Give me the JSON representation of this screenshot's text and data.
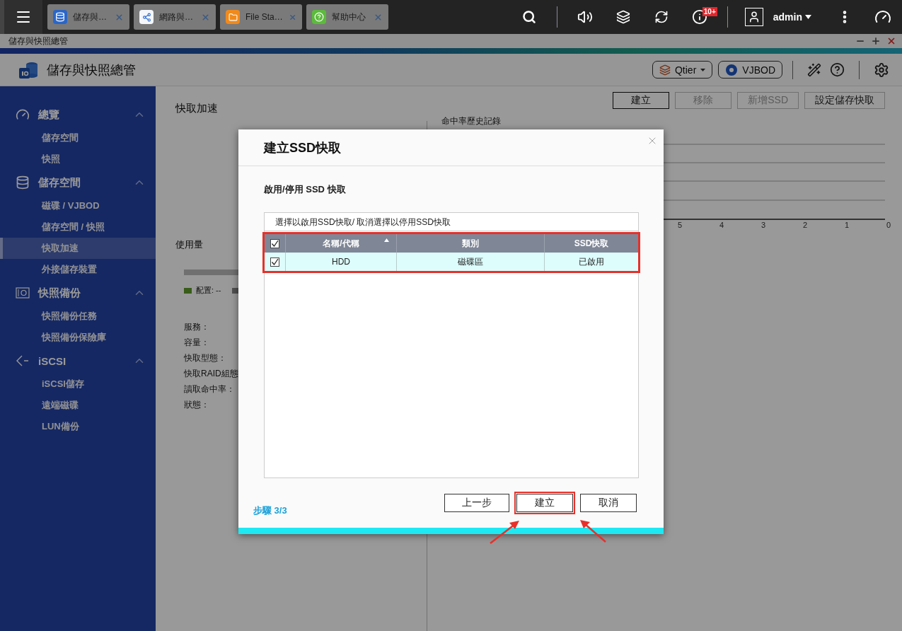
{
  "topbar": {
    "tabs": [
      {
        "label": "儲存與…"
      },
      {
        "label": "網路與…"
      },
      {
        "label": "File Sta…"
      },
      {
        "label": "幫助中心"
      }
    ],
    "notification_badge": "10+",
    "user": "admin"
  },
  "window": {
    "title": "儲存與快照總管"
  },
  "app_header": {
    "title": "儲存與快照總管",
    "qtier_label": "Qtier",
    "vjbod_label": "VJBOD"
  },
  "sidebar": {
    "groups": [
      {
        "label": "總覽",
        "expanded": true,
        "children": [
          {
            "label": "儲存空間",
            "selected": false
          },
          {
            "label": "快照",
            "selected": false
          }
        ]
      },
      {
        "label": "儲存空間",
        "expanded": true,
        "children": [
          {
            "label": "磁碟 / VJBOD",
            "selected": false
          },
          {
            "label": "儲存空間 / 快照",
            "selected": false
          },
          {
            "label": "快取加速",
            "selected": true
          },
          {
            "label": "外接儲存裝置",
            "selected": false
          }
        ]
      },
      {
        "label": "快照備份",
        "expanded": true,
        "children": [
          {
            "label": "快照備份任務",
            "selected": false
          },
          {
            "label": "快照備份保險庫",
            "selected": false
          }
        ]
      },
      {
        "label": "iSCSI",
        "expanded": true,
        "children": [
          {
            "label": "iSCSI儲存",
            "selected": false
          },
          {
            "label": "遠端磁碟",
            "selected": false
          },
          {
            "label": "LUN備份",
            "selected": false
          }
        ]
      }
    ]
  },
  "main": {
    "title": "快取加速",
    "actions": [
      {
        "label": "建立",
        "disabled": false,
        "focused": true
      },
      {
        "label": "移除",
        "disabled": true,
        "focused": false
      },
      {
        "label": "新增SSD",
        "disabled": true,
        "focused": false
      },
      {
        "label": "設定儲存快取",
        "disabled": false,
        "focused": false
      }
    ],
    "usage": {
      "title": "使用量",
      "legend": "配置: --"
    },
    "info_labels": [
      "服務：",
      "容量：",
      "快取型態：",
      "快取RAID組態",
      "讀取命中率：",
      "狀態："
    ],
    "chart": {
      "title": "命中率歷史記錄",
      "x_ticks": [
        "5",
        "4",
        "3",
        "2",
        "1",
        "0"
      ]
    }
  },
  "dialog": {
    "title": "建立SSD快取",
    "section_title": "啟用/停用 SSD 快取",
    "table": {
      "caption": "選擇以啟用SSD快取/ 取消選擇以停用SSD快取",
      "header_checked": true,
      "highlighted": true,
      "columns": [
        {
          "label": "名稱/代稱",
          "sorted": true
        },
        {
          "label": "類別",
          "sorted": false
        },
        {
          "label": "SSD快取",
          "sorted": false
        }
      ],
      "rows": [
        {
          "checked": true,
          "cells": [
            "HDD",
            "磁碟區",
            "已啟用"
          ]
        }
      ]
    },
    "step": "步驟 3/3",
    "buttons": [
      {
        "label": "上一步",
        "highlighted": false
      },
      {
        "label": "建立",
        "highlighted": true
      },
      {
        "label": "取消",
        "highlighted": false
      }
    ]
  }
}
